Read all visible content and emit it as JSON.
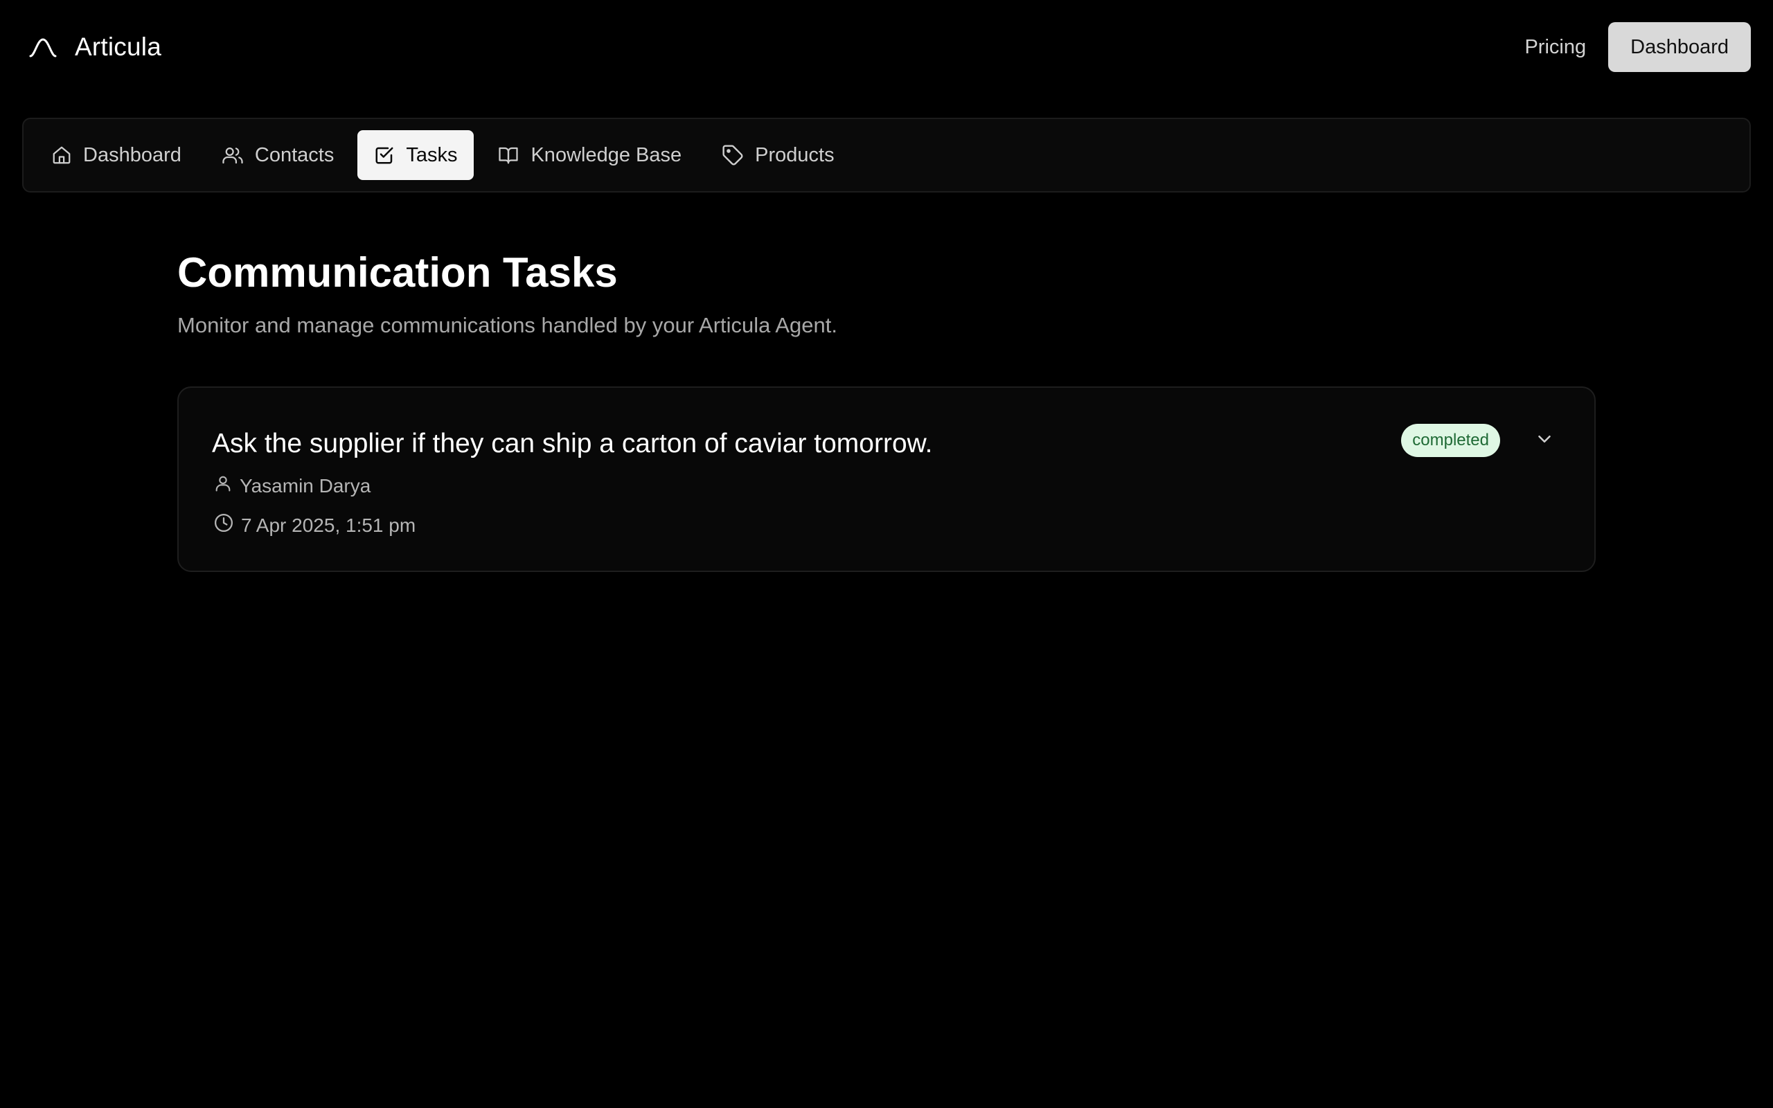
{
  "header": {
    "brand_name": "Articula",
    "brand_icon": "wave-logo-icon",
    "pricing_label": "Pricing",
    "dashboard_button_label": "Dashboard"
  },
  "nav": {
    "tabs": [
      {
        "label": "Dashboard",
        "icon": "home-icon",
        "active": false
      },
      {
        "label": "Contacts",
        "icon": "users-icon",
        "active": false
      },
      {
        "label": "Tasks",
        "icon": "checkbox-icon",
        "active": true
      },
      {
        "label": "Knowledge Base",
        "icon": "book-icon",
        "active": false
      },
      {
        "label": "Products",
        "icon": "tag-icon",
        "active": false
      }
    ]
  },
  "main": {
    "title": "Communication Tasks",
    "subtitle": "Monitor and manage communications handled by your Articula Agent.",
    "tasks": [
      {
        "title": "Ask the supplier if they can ship a carton of caviar tomorrow.",
        "contact": "Yasamin Darya",
        "timestamp": "7 Apr 2025, 1:51 pm",
        "status": "completed"
      }
    ]
  },
  "colors": {
    "background": "#000000",
    "status_completed_bg": "#dff7e4",
    "status_completed_text": "#1f6a35",
    "active_tab_bg": "#f4f4f4",
    "primary_button_bg": "#d9d9d9"
  }
}
